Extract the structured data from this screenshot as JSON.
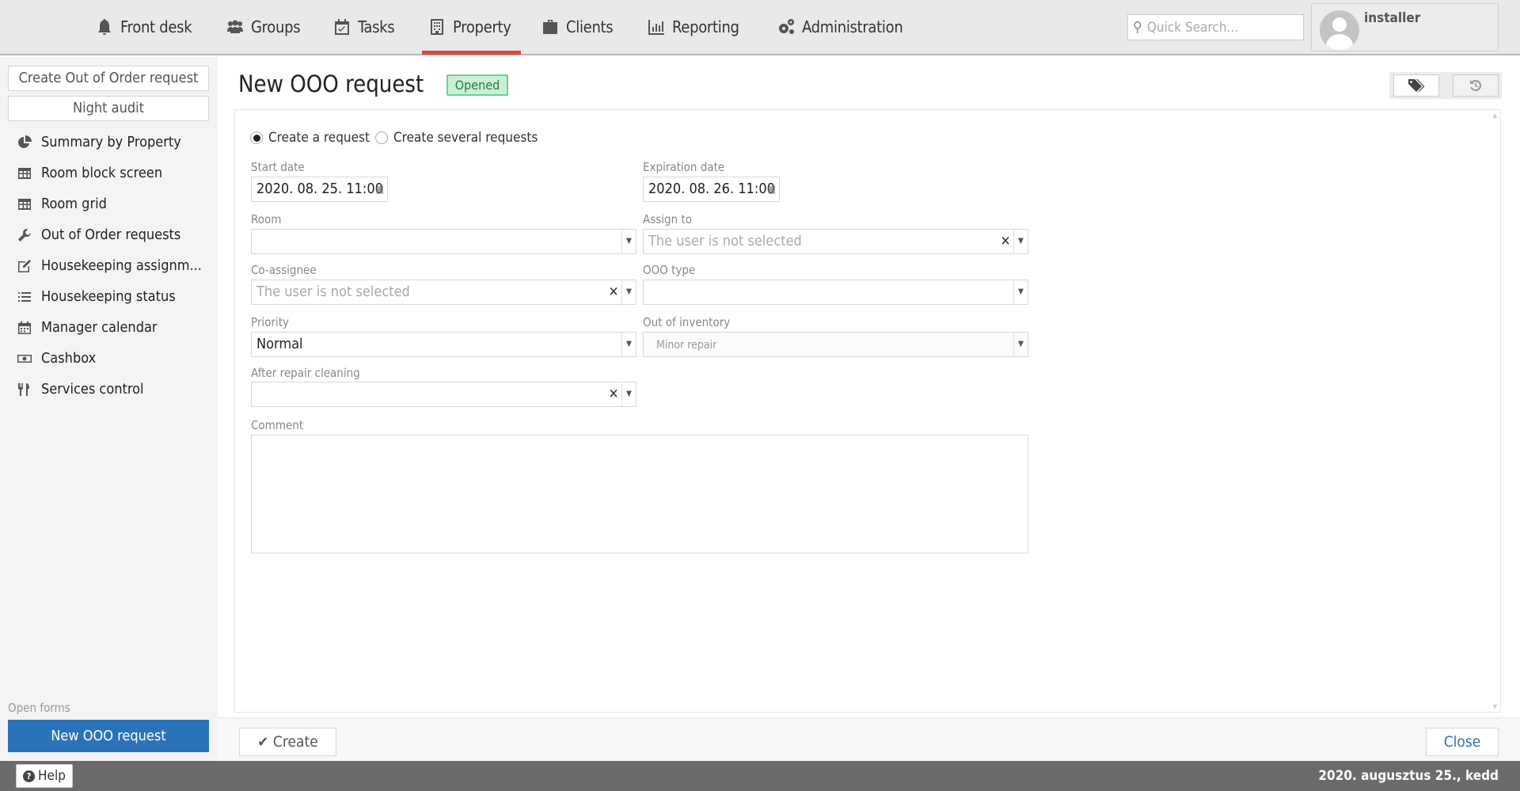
{
  "nav": {
    "items": [
      {
        "label": "Front desk",
        "icon": "bell-icon"
      },
      {
        "label": "Groups",
        "icon": "users-icon"
      },
      {
        "label": "Tasks",
        "icon": "calendar-check-icon"
      },
      {
        "label": "Property",
        "icon": "building-icon",
        "active": true
      },
      {
        "label": "Clients",
        "icon": "briefcase-icon"
      },
      {
        "label": "Reporting",
        "icon": "bar-chart-icon"
      },
      {
        "label": "Administration",
        "icon": "gears-icon"
      }
    ],
    "search_placeholder": "Quick Search...",
    "user": "installer",
    "accent": "#d9493a"
  },
  "sidebar": {
    "buttons": [
      "Create Out of Order request",
      "Night audit"
    ],
    "items": [
      {
        "label": "Summary by Property",
        "icon": "pie-chart-icon"
      },
      {
        "label": "Room block screen",
        "icon": "table-icon"
      },
      {
        "label": "Room grid",
        "icon": "table-icon"
      },
      {
        "label": "Out of Order requests",
        "icon": "wrench-icon"
      },
      {
        "label": "Housekeeping assignm...",
        "icon": "edit-icon"
      },
      {
        "label": "Housekeeping status",
        "icon": "list-icon"
      },
      {
        "label": "Manager calendar",
        "icon": "calendar-icon"
      },
      {
        "label": "Cashbox",
        "icon": "money-icon"
      },
      {
        "label": "Services control",
        "icon": "cutlery-icon"
      }
    ],
    "open_forms_label": "Open forms",
    "open_forms": [
      "New OOO request"
    ],
    "open_form_color": "#2b73b9"
  },
  "form": {
    "title": "New OOO request",
    "status": "Opened",
    "mode_options": [
      "Create a request",
      "Create several requests"
    ],
    "selected_mode": "Create a request",
    "fields": {
      "start_date": {
        "label": "Start date",
        "value": "2020. 08. 25. 11:00"
      },
      "expiration_date": {
        "label": "Expiration date",
        "value": "2020. 08. 26. 11:00"
      },
      "room": {
        "label": "Room",
        "value": ""
      },
      "assign_to": {
        "label": "Assign to",
        "placeholder": "The user is not selected"
      },
      "co_assignee": {
        "label": "Co-assignee",
        "placeholder": "The user is not selected"
      },
      "ooo_type": {
        "label": "OOO type",
        "value": ""
      },
      "priority": {
        "label": "Priority",
        "value": "Normal"
      },
      "out_of_inventory": {
        "label": "Out of inventory",
        "value": "Minor repair"
      },
      "after_repair_cleaning": {
        "label": "After repair cleaning",
        "value": ""
      },
      "comment": {
        "label": "Comment",
        "value": ""
      }
    },
    "create_label": "Create",
    "close_label": "Close"
  },
  "footer": {
    "help_label": "Help",
    "date": "2020. augusztus 25., kedd"
  }
}
